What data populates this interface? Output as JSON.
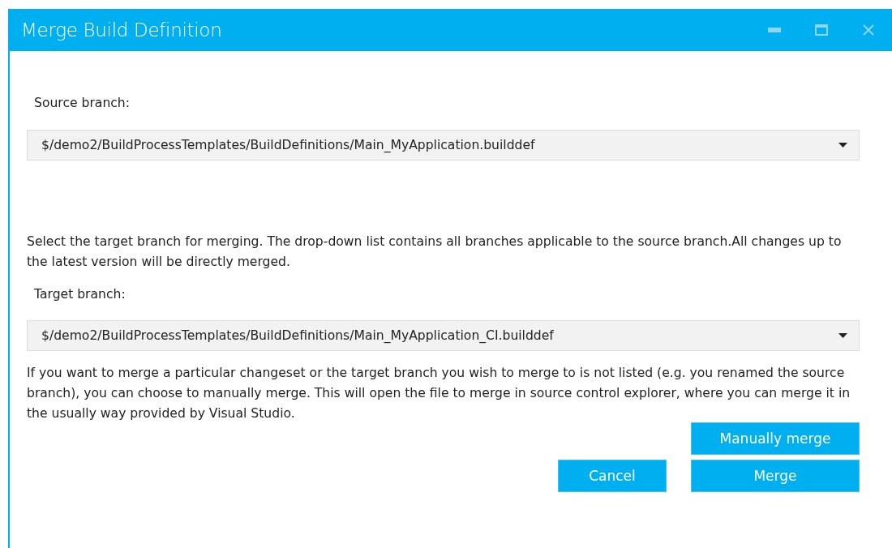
{
  "window": {
    "title": "Merge Build Definition"
  },
  "source": {
    "label": "Source branch:",
    "value": "$/demo2/BuildProcessTemplates/BuildDefinitions/Main_MyApplication.builddef"
  },
  "target_help": "Select the target branch for merging. The drop-down list contains all branches applicable to the source branch.All changes up to the latest version will be directly merged.",
  "target": {
    "label": "Target branch:",
    "value": "$/demo2/BuildProcessTemplates/BuildDefinitions/Main_MyApplication_CI.builddef"
  },
  "manual_help": "If you want to merge a particular changeset or the target branch you wish to merge to is not listed (e.g. you renamed the source branch), you can choose to manually merge. This will open the file to merge in source control explorer, where you can merge it in the usually way provided by Visual Studio.",
  "buttons": {
    "manual": "Manually merge",
    "cancel": "Cancel",
    "merge": "Merge"
  }
}
